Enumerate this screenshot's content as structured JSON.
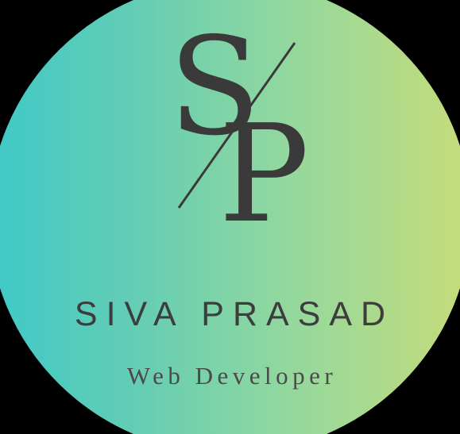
{
  "logo": {
    "monogram_first": "S",
    "monogram_slash": "/",
    "monogram_second": "P",
    "name": "SIVA PRASAD",
    "subtitle": "Web Developer"
  },
  "colors": {
    "background": "#000000",
    "gradient_left": "#3fc9c9",
    "gradient_right": "#c6dc79",
    "text": "#3a3a3a"
  }
}
